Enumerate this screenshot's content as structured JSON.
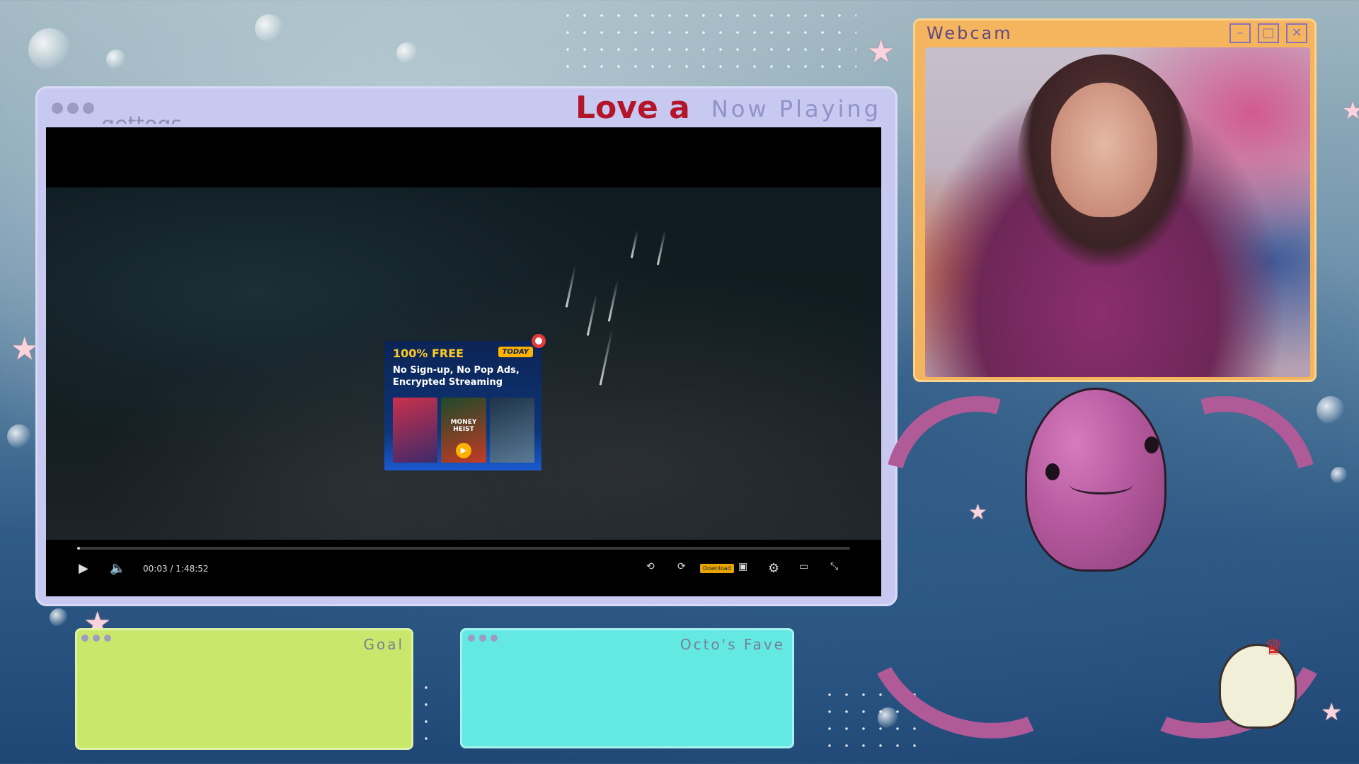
{
  "background": {
    "colors": {
      "top": "#9fb6bf",
      "bottom": "#1f4775"
    }
  },
  "now_playing": {
    "title": "Now Playing",
    "marquee_text": "Love a",
    "marquee_ghost_text": "gettogs",
    "colors": {
      "frame": "#c7c9f0",
      "title": "#8f93c7",
      "marquee": "#b3162a"
    },
    "player": {
      "current_time": "00:03",
      "separator": "/",
      "duration": "1:48:52",
      "progress_fraction": 0.0005,
      "download_label": "Download",
      "icons": [
        "play-icon",
        "volume-icon",
        "rewind-10-icon",
        "forward-10-icon",
        "download-icon",
        "captions-icon",
        "settings-icon",
        "picture-in-picture-icon",
        "fullscreen-icon"
      ]
    },
    "ad": {
      "headline": "100% FREE",
      "brand": "TODAY",
      "body": "No Sign-up, No Pop Ads, Encrypted Streaming",
      "poster_label": "MONEY HEIST",
      "colors": {
        "headline": "#ffc928",
        "bg": "#0e3578"
      }
    }
  },
  "webcam": {
    "title": "Webcam",
    "window_buttons": [
      "minimize-icon",
      "maximize-icon",
      "close-icon"
    ],
    "colors": {
      "frame": "#f5b45e",
      "title": "#5f4a84"
    }
  },
  "panels": {
    "goal": {
      "title": "Goal",
      "color": "#c9e86b"
    },
    "fave": {
      "title": "Octo's Fave",
      "color": "#63e8e2"
    }
  },
  "mascot": {
    "octopus_color": "#b05a98"
  }
}
